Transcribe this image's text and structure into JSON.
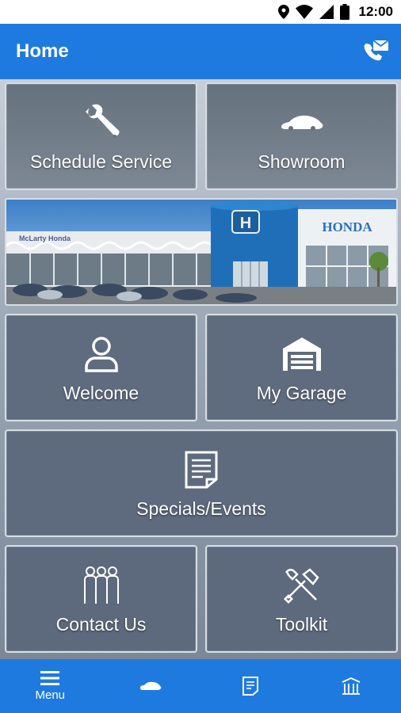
{
  "status_bar": {
    "time": "12:00"
  },
  "app_bar": {
    "title": "Home"
  },
  "tiles": {
    "schedule_service": "Schedule Service",
    "showroom": "Showroom",
    "welcome": "Welcome",
    "my_garage": "My Garage",
    "specials_events": "Specials/Events",
    "contact_us": "Contact Us",
    "toolkit": "Toolkit"
  },
  "banner": {
    "dealer_sign": "McLarty Honda",
    "brand_sign": "HONDA"
  },
  "bottom_nav": {
    "menu_label": "Menu"
  },
  "colors": {
    "accent": "#1f7ae0",
    "tile": "#5a667a",
    "tile_border": "#d7dde5"
  }
}
